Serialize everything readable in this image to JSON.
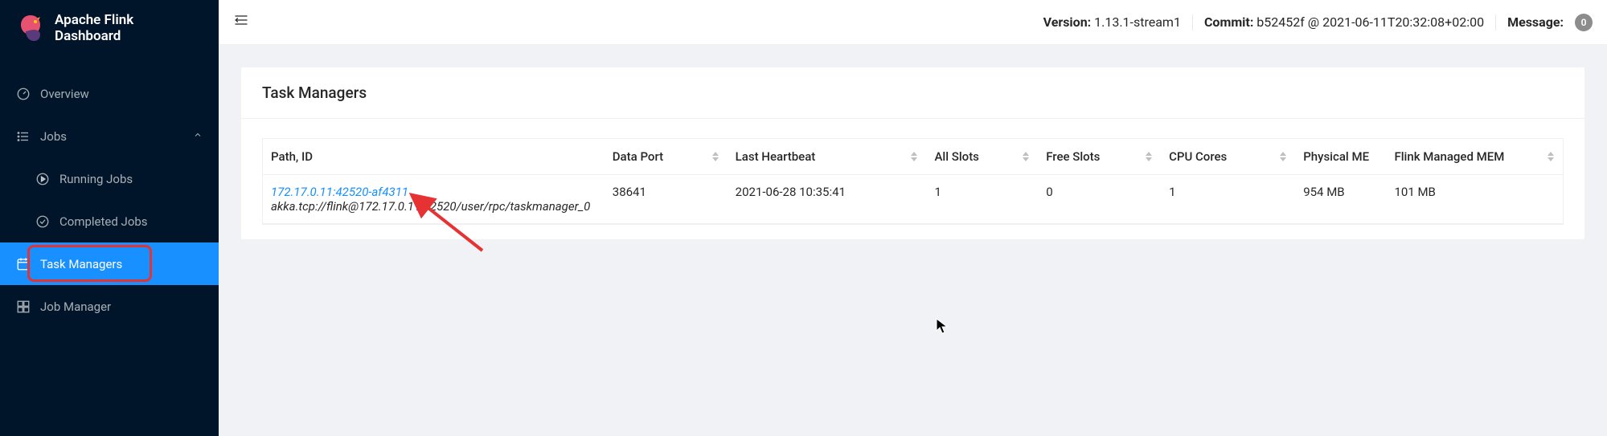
{
  "brand": "Apache Flink Dashboard",
  "topbar": {
    "version_label": "Version:",
    "version": "1.13.1-stream1",
    "commit_label": "Commit:",
    "commit": "b52452f @ 2021-06-11T20:32:08+02:00",
    "message_label": "Message:",
    "message_count": "0"
  },
  "sidebar": {
    "overview": "Overview",
    "jobs": "Jobs",
    "running_jobs": "Running Jobs",
    "completed_jobs": "Completed Jobs",
    "task_managers": "Task Managers",
    "job_manager": "Job Manager"
  },
  "page": {
    "title": "Task Managers"
  },
  "table": {
    "columns": {
      "path_id": "Path, ID",
      "data_port": "Data Port",
      "last_heartbeat": "Last Heartbeat",
      "all_slots": "All Slots",
      "free_slots": "Free Slots",
      "cpu_cores": "CPU Cores",
      "physical_mem": "Physical ME",
      "managed_mem": "Flink Managed MEM"
    },
    "rows": [
      {
        "id_link": "172.17.0.11:42520-af4311",
        "path": "akka.tcp://flink@172.17.0.11:42520/user/rpc/taskmanager_0",
        "data_port": "38641",
        "last_heartbeat": "2021-06-28 10:35:41",
        "all_slots": "1",
        "free_slots": "0",
        "cpu_cores": "1",
        "physical_mem": "954 MB",
        "managed_mem": "101 MB"
      }
    ]
  }
}
